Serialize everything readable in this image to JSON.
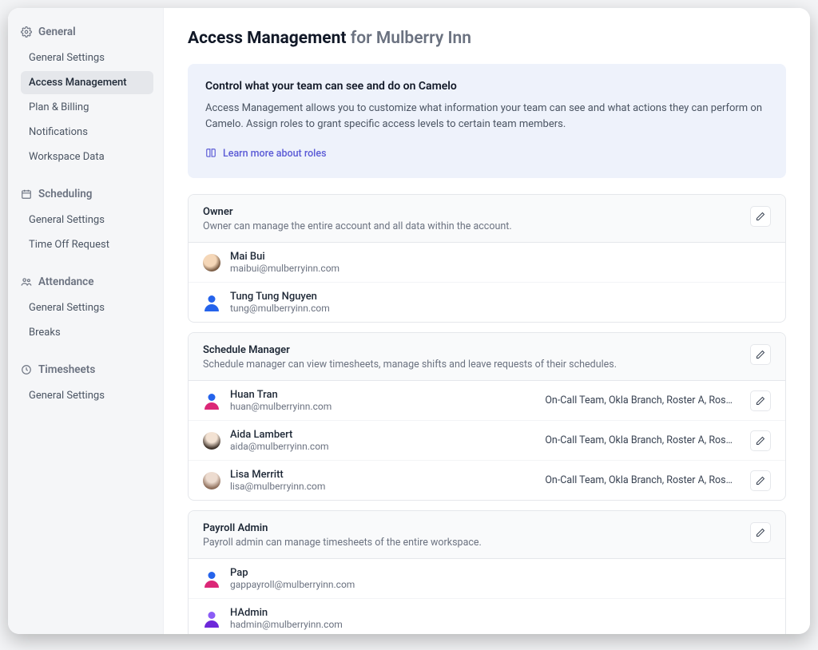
{
  "sidebar": {
    "sections": [
      {
        "id": "general",
        "header": "General",
        "icon": "gear",
        "items": [
          {
            "label": "General Settings"
          },
          {
            "label": "Access Management",
            "active": true
          },
          {
            "label": "Plan & Billing"
          },
          {
            "label": "Notifications"
          },
          {
            "label": "Workspace Data"
          }
        ]
      },
      {
        "id": "scheduling",
        "header": "Scheduling",
        "icon": "calendar",
        "items": [
          {
            "label": "General Settings"
          },
          {
            "label": "Time Off Request"
          }
        ]
      },
      {
        "id": "attendance",
        "header": "Attendance",
        "icon": "people",
        "items": [
          {
            "label": "General Settings"
          },
          {
            "label": "Breaks"
          }
        ]
      },
      {
        "id": "timesheets",
        "header": "Timesheets",
        "icon": "clock",
        "items": [
          {
            "label": "General Settings"
          }
        ]
      }
    ]
  },
  "page": {
    "title_prefix": "Access Management",
    "title_suffix": "for Mulberry Inn"
  },
  "info": {
    "title": "Control what your team can see and do on Camelo",
    "body": "Access Management allows you to customize what information your team can see and what actions they can perform on Camelo. Assign roles to grant specific access levels to certain team members.",
    "link_label": "Learn more about roles"
  },
  "roles": [
    {
      "name": "Owner",
      "description": "Owner can manage the entire account and all data within the account.",
      "members": [
        {
          "name": "Mai Bui",
          "email": "maibui@mulberryinn.com",
          "avatar": "photo1"
        },
        {
          "name": "Tung Tung Nguyen",
          "email": "tung@mulberryinn.com",
          "avatar": "blue"
        }
      ]
    },
    {
      "name": "Schedule Manager",
      "description": "Schedule manager can view timesheets, manage shifts and leave requests of their schedules.",
      "members": [
        {
          "name": "Huan Tran",
          "email": "huan@mulberryinn.com",
          "avatar": "blue pink",
          "scope": "On-Call Team, Okla Branch, Roster A, Ros…",
          "editable": true
        },
        {
          "name": "Aida Lambert",
          "email": "aida@mulberryinn.com",
          "avatar": "photo2",
          "scope": "On-Call Team, Okla Branch, Roster A, Ros…",
          "editable": true
        },
        {
          "name": "Lisa Merritt",
          "email": "lisa@mulberryinn.com",
          "avatar": "photo3",
          "scope": "On-Call Team, Okla Branch, Roster A, Ros…",
          "editable": true
        }
      ]
    },
    {
      "name": "Payroll Admin",
      "description": "Payroll admin can manage timesheets of the entire workspace.",
      "members": [
        {
          "name": "Pap",
          "email": "gappayroll@mulberryinn.com",
          "avatar": "blue pink"
        },
        {
          "name": "HAdmin",
          "email": "hadmin@mulberryinn.com",
          "avatar": "violet blue"
        }
      ]
    }
  ]
}
